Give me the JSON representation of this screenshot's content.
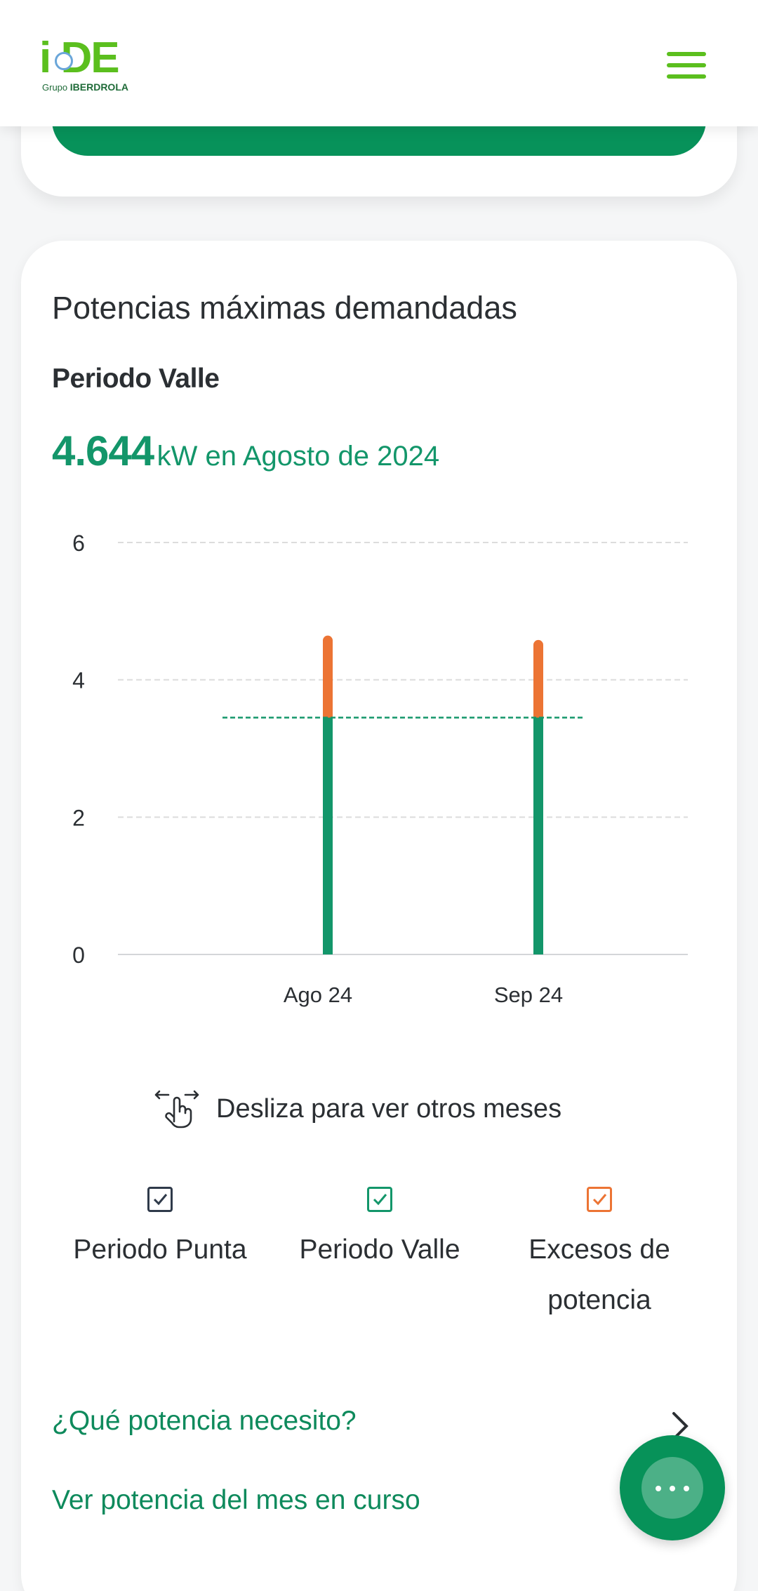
{
  "header": {
    "logo_text": "i-DE",
    "logo_group_prefix": "Grupo",
    "logo_group_brand": "IBERDROLA"
  },
  "card": {
    "title": "Potencias máximas demandadas",
    "period_label": "Periodo Valle",
    "highlight_value": "4.644",
    "highlight_suffix": "kW en Agosto de 2024"
  },
  "swipe_hint": "Desliza para ver otros meses",
  "legend": [
    {
      "label": "Periodo Punta",
      "color": "#2f3a4a",
      "checked": true
    },
    {
      "label": "Periodo Valle",
      "color": "#13966a",
      "checked": true
    },
    {
      "label": "Excesos de potencia",
      "color": "#ec7434",
      "checked": true
    }
  ],
  "links": {
    "q1": "¿Qué potencia necesito?",
    "q2": "Ver potencia del mes en curso"
  },
  "colors": {
    "valle": "#13966a",
    "exceso": "#ec7434",
    "brand_green": "#5bbf1e",
    "button_green": "#07925a"
  },
  "icons": {
    "menu": "hamburger-menu-icon",
    "swipe": "swipe-hand-icon",
    "chevron": "chevron-right-icon",
    "fab": "chat-ellipsis-icon"
  },
  "chart_data": {
    "type": "bar",
    "stacked": true,
    "categories": [
      "Ago 24",
      "Sep 24"
    ],
    "series": [
      {
        "name": "Periodo Valle",
        "values": [
          3.45,
          3.45
        ],
        "color": "#13966a"
      },
      {
        "name": "Excesos de potencia",
        "values": [
          1.194,
          1.13
        ],
        "color": "#ec7434"
      }
    ],
    "contracted_power_line": 3.45,
    "ylim": [
      0,
      6
    ],
    "yticks": [
      0,
      2,
      4,
      6
    ],
    "grid": true,
    "xlabel": "",
    "ylabel": ""
  }
}
